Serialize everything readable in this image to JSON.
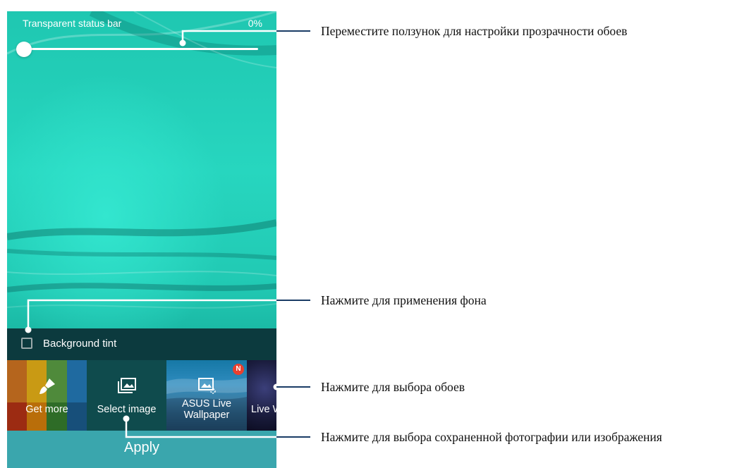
{
  "status_bar_setting": {
    "label": "Transparent status bar",
    "value": "0%",
    "slider_level": 0
  },
  "background_tint": {
    "label": "Background tint",
    "checked": false
  },
  "wallpaper_picker": {
    "tiles": [
      {
        "label": "Get more",
        "icon": "paintbrush-icon"
      },
      {
        "label": "Select image",
        "icon": "gallery-icon"
      },
      {
        "label": "ASUS Live\nWallpaper",
        "icon": "live-wallpaper-icon",
        "badge": "N"
      },
      {
        "label": "Live W",
        "icon": "none"
      }
    ]
  },
  "apply_button": {
    "label": "Apply"
  },
  "callouts": [
    {
      "text": "Переместите ползунок для настройки прозрачности обоев"
    },
    {
      "text": "Нажмите для применения фона"
    },
    {
      "text": "Нажмите для выбора обоев"
    },
    {
      "text": "Нажмите для выбора сохраненной фотографии или изображения"
    }
  ],
  "colors": {
    "wallpaper_teal": "#21c9b3",
    "apply_bar": "#3aa6ad",
    "tint_bar": "#0c3a3e",
    "badge_red": "#e8402f"
  }
}
